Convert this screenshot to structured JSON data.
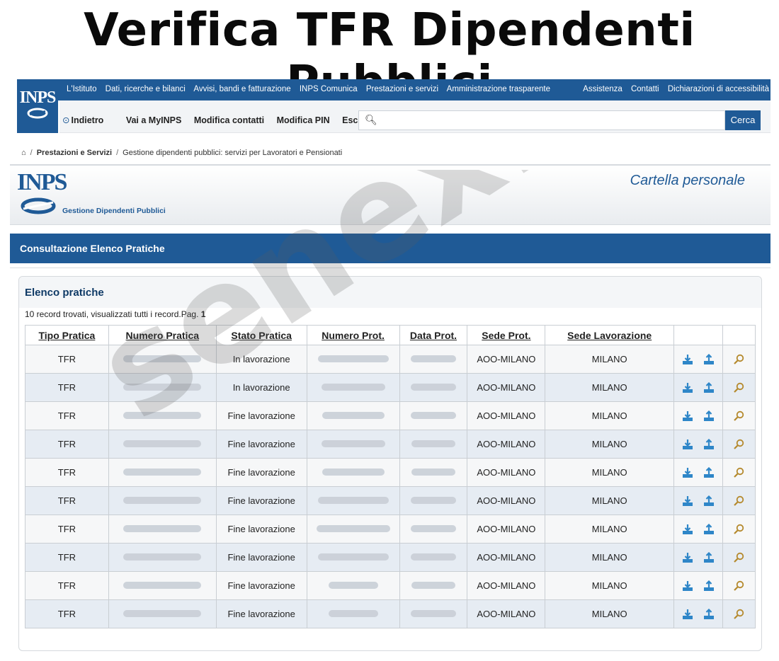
{
  "headline": "Verifica TFR Dipendenti Pubblici",
  "logo_text": "INPS",
  "top_links_left": [
    "L'Istituto",
    "Dati, ricerche e bilanci",
    "Avvisi, bandi e fatturazione",
    "INPS Comunica",
    "Prestazioni e servizi",
    "Amministrazione trasparente"
  ],
  "top_links_right": [
    "Assistenza",
    "Contatti",
    "Dichiarazioni di accessibilità"
  ],
  "nav": {
    "back": "Indietro",
    "myinps": "Vai a MyINPS",
    "contacts": "Modifica contatti",
    "pin": "Modifica PIN",
    "exit": "Esci"
  },
  "search": {
    "value": "",
    "button": "Cerca"
  },
  "breadcrumb": {
    "level1": "Prestazioni e Servizi",
    "level2": "Gestione dipendenti pubblici: servizi per Lavoratori e Pensionati"
  },
  "brand": {
    "subtitle": "Gestione Dipendenti Pubblici",
    "right_title": "Cartella personale"
  },
  "section_title": "Consultazione Elenco Pratiche",
  "panel": {
    "title": "Elenco pratiche",
    "record_info": "10 record trovati, visualizzati tutti i record.Pag.",
    "page": "1"
  },
  "columns": [
    "Tipo Pratica",
    "Numero Pratica",
    "Stato Pratica",
    "Numero Prot.",
    "Data Prot.",
    "Sede Prot.",
    "Sede Lavorazione"
  ],
  "rows": [
    {
      "tipo": "TFR",
      "stato": "In lavorazione",
      "sede_prot": "AOO-MILANO",
      "sede_lav": "MILANO"
    },
    {
      "tipo": "TFR",
      "stato": "In lavorazione",
      "sede_prot": "AOO-MILANO",
      "sede_lav": "MILANO"
    },
    {
      "tipo": "TFR",
      "stato": "Fine lavorazione",
      "sede_prot": "AOO-MILANO",
      "sede_lav": "MILANO"
    },
    {
      "tipo": "TFR",
      "stato": "Fine lavorazione",
      "sede_prot": "AOO-MILANO",
      "sede_lav": "MILANO"
    },
    {
      "tipo": "TFR",
      "stato": "Fine lavorazione",
      "sede_prot": "AOO-MILANO",
      "sede_lav": "MILANO"
    },
    {
      "tipo": "TFR",
      "stato": "Fine lavorazione",
      "sede_prot": "AOO-MILANO",
      "sede_lav": "MILANO"
    },
    {
      "tipo": "TFR",
      "stato": "Fine lavorazione",
      "sede_prot": "AOO-MILANO",
      "sede_lav": "MILANO"
    },
    {
      "tipo": "TFR",
      "stato": "Fine lavorazione",
      "sede_prot": "AOO-MILANO",
      "sede_lav": "MILANO"
    },
    {
      "tipo": "TFR",
      "stato": "Fine lavorazione",
      "sede_prot": "AOO-MILANO",
      "sede_lav": "MILANO"
    },
    {
      "tipo": "TFR",
      "stato": "Fine lavorazione",
      "sede_prot": "AOO-MILANO",
      "sede_lav": "MILANO"
    }
  ],
  "watermark": "senex.it",
  "colors": {
    "brand_blue": "#1f5a96",
    "action_icon": "#2e86c8",
    "row_alt": "#e6ecf3"
  },
  "icons": [
    "home-icon",
    "back-arrow-icon",
    "search-icon",
    "download-icon",
    "upload-icon",
    "magnifier-icon"
  ]
}
